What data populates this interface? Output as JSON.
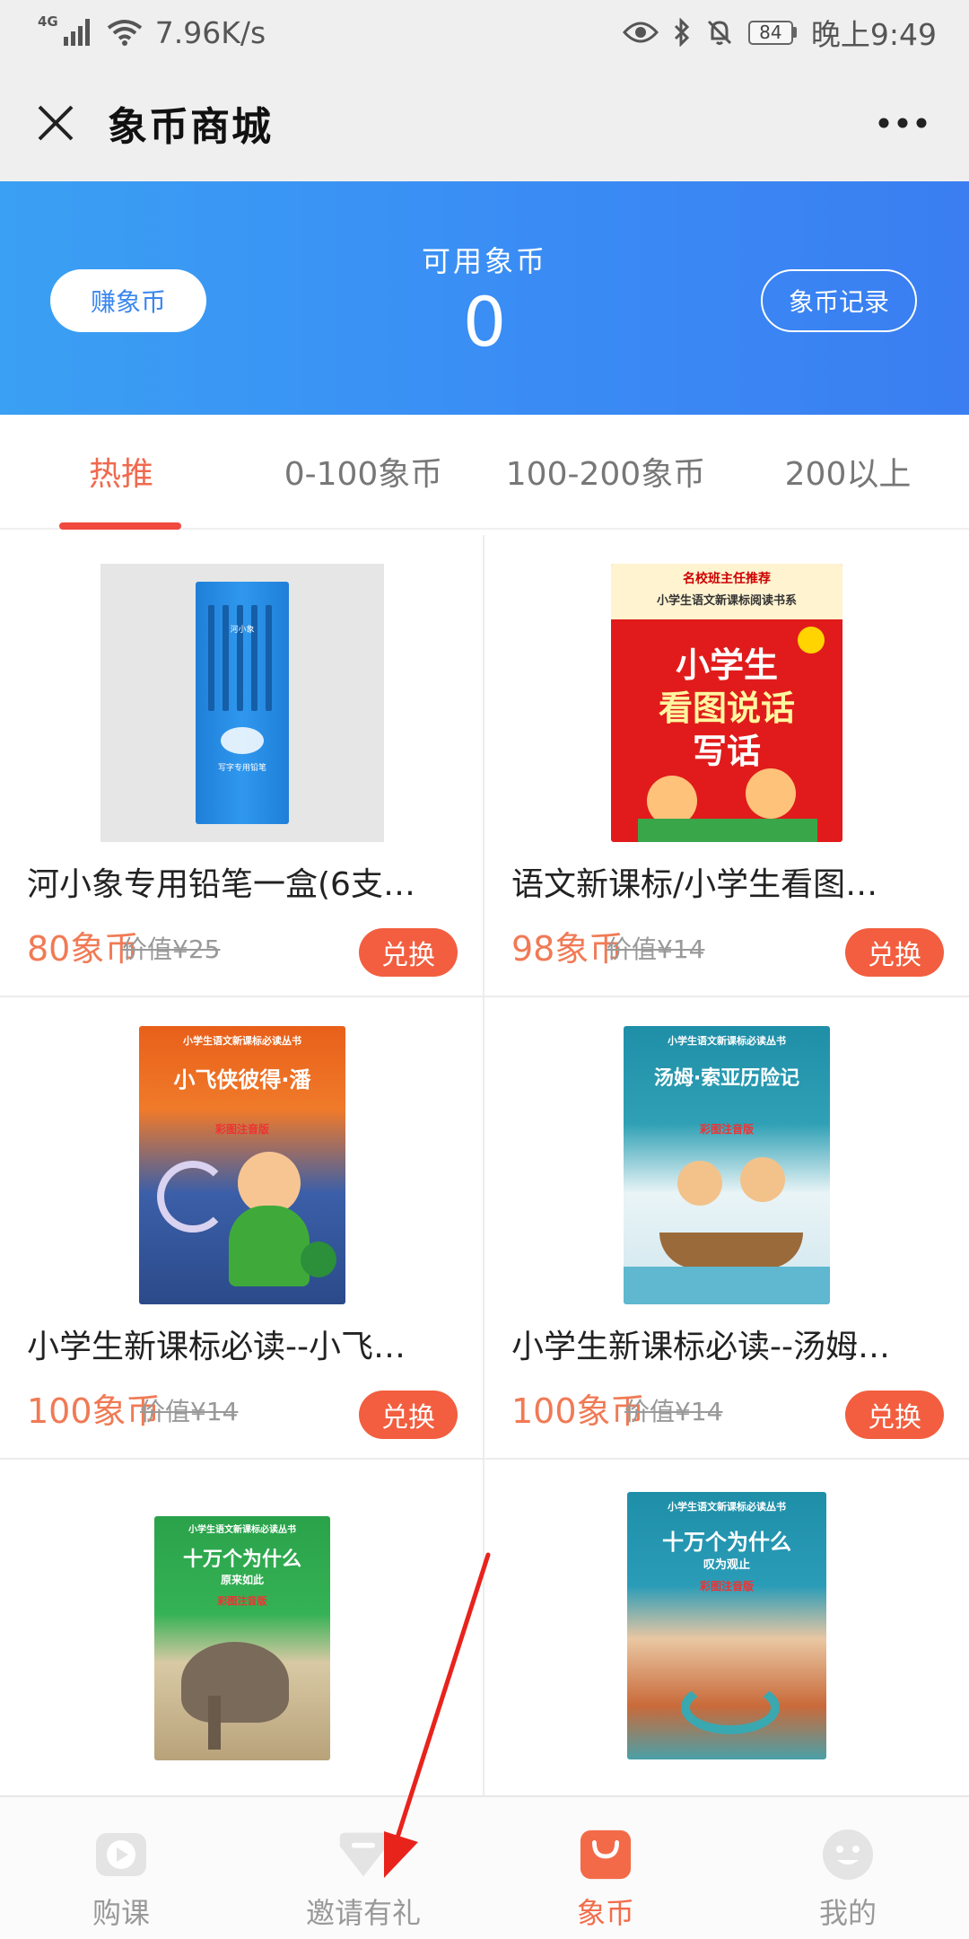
{
  "status_bar": {
    "network_type": "4G",
    "speed": "7.96K/s",
    "battery": "84",
    "time": "晚上9:49"
  },
  "nav": {
    "title": "象币商城"
  },
  "banner": {
    "earn_label": "赚象币",
    "coin_label": "可用象币",
    "coin_value": "0",
    "record_label": "象币记录",
    "gradient_colors": [
      "#3aa0f3",
      "#3a7ef2"
    ]
  },
  "tabs": [
    {
      "label": "热推",
      "active": true
    },
    {
      "label": "0-100象币",
      "active": false
    },
    {
      "label": "100-200象币",
      "active": false
    },
    {
      "label": "200以上",
      "active": false
    }
  ],
  "products": [
    {
      "name": "河小象专用铅笔一盒(6支…",
      "price": "80象币",
      "original": "价值¥25",
      "button": "兑换",
      "image": "pencil-box",
      "cover_text": [
        "河小象",
        "写字专用铅笔"
      ]
    },
    {
      "name": "语文新课标/小学生看图…",
      "price": "98象币",
      "original": "价值¥14",
      "button": "兑换",
      "image": "book-red",
      "cover_text": [
        "名校班主任推荐",
        "小学生语文新课标阅读书系",
        "小学生",
        "看图说话",
        "写话"
      ]
    },
    {
      "name": "小学生新课标必读--小飞…",
      "price": "100象币",
      "original": "价值¥14",
      "button": "兑换",
      "image": "book-orange",
      "cover_text": [
        "小学生语文新课标必读丛书",
        "小飞侠彼得·潘",
        "彩图注音版"
      ]
    },
    {
      "name": "小学生新课标必读--汤姆…",
      "price": "100象币",
      "original": "价值¥14",
      "button": "兑换",
      "image": "book-teal",
      "cover_text": [
        "小学生语文新课标必读丛书",
        "汤姆·索亚历险记",
        "彩图注音版"
      ]
    },
    {
      "image": "book-green",
      "cover_text": [
        "小学生语文新课标必读丛书",
        "十万个为什么",
        "原来如此",
        "彩图注音版"
      ]
    },
    {
      "image": "book-canyon",
      "cover_text": [
        "小学生语文新课标必读丛书",
        "十万个为什么",
        "叹为观止",
        "彩图注音版"
      ]
    }
  ],
  "bottom_tabs": [
    {
      "label": "购课",
      "icon": "play-icon",
      "active": false
    },
    {
      "label": "邀请有礼",
      "icon": "gift-icon",
      "active": false
    },
    {
      "label": "象币",
      "icon": "shopping-bag-icon",
      "active": true
    },
    {
      "label": "我的",
      "icon": "face-icon",
      "active": false
    }
  ],
  "colors": {
    "accent": "#f25e3f",
    "price": "#f07a55",
    "tab_active": "#f0694f",
    "banner": "#3a8cf4"
  }
}
